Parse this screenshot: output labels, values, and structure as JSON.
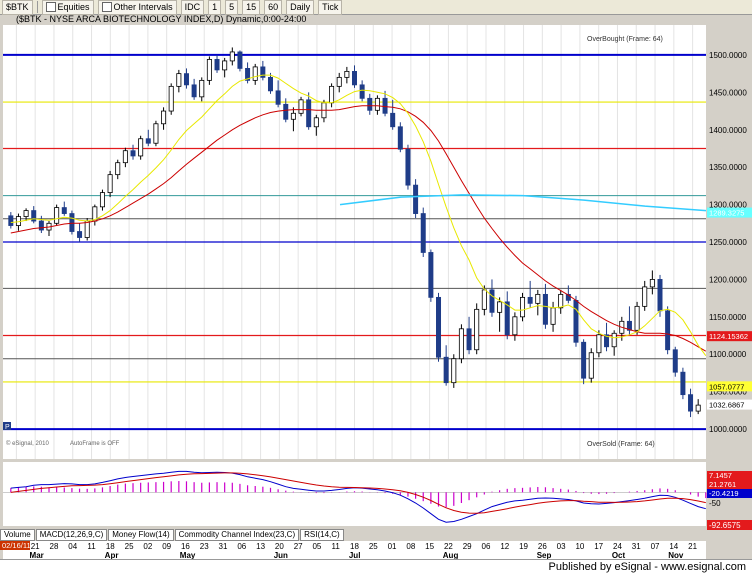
{
  "toolbar": {
    "symbol": "$BTK",
    "equities_label": "Equities",
    "other_intervals_label": "Other Intervals",
    "idc_label": "IDC",
    "intervals": [
      "1",
      "5",
      "15",
      "60",
      "Daily",
      "Tick"
    ]
  },
  "chart_data": {
    "type": "candlestick",
    "title": "($BTK - NYSE ARCA BIOTECHNOLOGY INDEX,D) Dynamic,0:00-24:00",
    "ylim": [
      960,
      1540
    ],
    "y_ticks": [
      "1500.0000",
      "1450.0000",
      "1400.0000",
      "1350.0000",
      "1300.0000",
      "1250.0000",
      "1200.0000",
      "1150.0000",
      "1100.0000",
      "1050.0000",
      "1000.0000"
    ],
    "x_day_labels": [
      "14",
      "21",
      "28",
      "04",
      "11",
      "18",
      "25",
      "02",
      "09",
      "16",
      "23",
      "31",
      "06",
      "13",
      "20",
      "27",
      "05",
      "11",
      "18",
      "25",
      "01",
      "08",
      "15",
      "22",
      "29",
      "06",
      "12",
      "19",
      "26",
      "03",
      "10",
      "17",
      "24",
      "31",
      "07",
      "14",
      "21"
    ],
    "x_month_labels": [
      "Mar",
      "Apr",
      "May",
      "Jun",
      "Jul",
      "Aug",
      "Sep",
      "Oct",
      "Nov"
    ],
    "date_label": "02/16/11",
    "price_labels": [
      {
        "text": "1124.15362",
        "value": 1124.15,
        "color": "#e31a1c"
      },
      {
        "text": "1057.0777",
        "value": 1057.08,
        "color": "#ffff33"
      },
      {
        "text": "1032.6867",
        "value": 1032.69,
        "color": "#ffffff"
      },
      {
        "text": "1289.3275",
        "value": 1289.33,
        "color": "#66ffff"
      }
    ],
    "horizontal_levels": [
      {
        "value": 1500,
        "color": "#0000cc",
        "width": 2
      },
      {
        "value": 1437,
        "color": "#e8e800",
        "width": 1.2
      },
      {
        "value": 1375,
        "color": "#e31a1c",
        "width": 1.2
      },
      {
        "value": 1312,
        "color": "#339999",
        "width": 1
      },
      {
        "value": 1281,
        "color": "#555555",
        "width": 1
      },
      {
        "value": 1250,
        "color": "#0000cc",
        "width": 1.2
      },
      {
        "value": 1188,
        "color": "#555555",
        "width": 1
      },
      {
        "value": 1125,
        "color": "#e31a1c",
        "width": 1.2
      },
      {
        "value": 1094,
        "color": "#555555",
        "width": 1
      },
      {
        "value": 1063,
        "color": "#e8e800",
        "width": 1.2
      },
      {
        "value": 1000,
        "color": "#0000cc",
        "width": 2
      }
    ],
    "annotations": {
      "overbought": "OverBought (Frame: 64)",
      "oversold": "OverSold (Frame: 64)",
      "autoframe": "AutoFrame is OFF",
      "copyright": "© eSignal, 2010"
    },
    "candles": [
      [
        1285,
        1290,
        1268,
        1272
      ],
      [
        1272,
        1288,
        1265,
        1284
      ],
      [
        1284,
        1295,
        1278,
        1292
      ],
      [
        1292,
        1298,
        1275,
        1278
      ],
      [
        1278,
        1285,
        1262,
        1266
      ],
      [
        1266,
        1278,
        1258,
        1275
      ],
      [
        1275,
        1300,
        1272,
        1296
      ],
      [
        1296,
        1304,
        1285,
        1288
      ],
      [
        1288,
        1292,
        1260,
        1264
      ],
      [
        1264,
        1275,
        1250,
        1256
      ],
      [
        1256,
        1282,
        1252,
        1278
      ],
      [
        1278,
        1300,
        1272,
        1297
      ],
      [
        1297,
        1320,
        1292,
        1316
      ],
      [
        1316,
        1345,
        1310,
        1340
      ],
      [
        1340,
        1360,
        1334,
        1356
      ],
      [
        1356,
        1376,
        1350,
        1372
      ],
      [
        1372,
        1380,
        1360,
        1365
      ],
      [
        1365,
        1392,
        1360,
        1388
      ],
      [
        1388,
        1400,
        1378,
        1382
      ],
      [
        1382,
        1412,
        1378,
        1408
      ],
      [
        1408,
        1430,
        1400,
        1425
      ],
      [
        1425,
        1462,
        1420,
        1458
      ],
      [
        1458,
        1480,
        1450,
        1475
      ],
      [
        1475,
        1482,
        1455,
        1460
      ],
      [
        1460,
        1468,
        1440,
        1444
      ],
      [
        1444,
        1470,
        1438,
        1466
      ],
      [
        1466,
        1498,
        1460,
        1494
      ],
      [
        1494,
        1500,
        1476,
        1480
      ],
      [
        1480,
        1496,
        1470,
        1492
      ],
      [
        1492,
        1510,
        1486,
        1504
      ],
      [
        1504,
        1506,
        1478,
        1482
      ],
      [
        1482,
        1490,
        1462,
        1466
      ],
      [
        1466,
        1488,
        1460,
        1484
      ],
      [
        1484,
        1492,
        1466,
        1470
      ],
      [
        1470,
        1476,
        1448,
        1452
      ],
      [
        1452,
        1466,
        1430,
        1434
      ],
      [
        1434,
        1442,
        1410,
        1414
      ],
      [
        1414,
        1430,
        1398,
        1422
      ],
      [
        1422,
        1444,
        1418,
        1440
      ],
      [
        1440,
        1450,
        1400,
        1404
      ],
      [
        1404,
        1420,
        1392,
        1416
      ],
      [
        1416,
        1440,
        1410,
        1436
      ],
      [
        1436,
        1462,
        1430,
        1458
      ],
      [
        1458,
        1476,
        1450,
        1470
      ],
      [
        1470,
        1484,
        1462,
        1478
      ],
      [
        1478,
        1486,
        1456,
        1460
      ],
      [
        1460,
        1466,
        1438,
        1442
      ],
      [
        1442,
        1448,
        1420,
        1426
      ],
      [
        1426,
        1446,
        1420,
        1442
      ],
      [
        1442,
        1452,
        1418,
        1422
      ],
      [
        1422,
        1440,
        1400,
        1404
      ],
      [
        1404,
        1410,
        1370,
        1374
      ],
      [
        1374,
        1380,
        1320,
        1326
      ],
      [
        1326,
        1334,
        1282,
        1288
      ],
      [
        1288,
        1296,
        1230,
        1236
      ],
      [
        1236,
        1240,
        1170,
        1176
      ],
      [
        1176,
        1182,
        1090,
        1096
      ],
      [
        1096,
        1112,
        1058,
        1062
      ],
      [
        1062,
        1100,
        1055,
        1094
      ],
      [
        1094,
        1140,
        1088,
        1134
      ],
      [
        1134,
        1150,
        1100,
        1106
      ],
      [
        1106,
        1168,
        1100,
        1160
      ],
      [
        1160,
        1192,
        1152,
        1186
      ],
      [
        1186,
        1200,
        1150,
        1156
      ],
      [
        1156,
        1176,
        1130,
        1170
      ],
      [
        1170,
        1184,
        1120,
        1126
      ],
      [
        1126,
        1156,
        1118,
        1150
      ],
      [
        1150,
        1182,
        1144,
        1176
      ],
      [
        1176,
        1198,
        1162,
        1168
      ],
      [
        1168,
        1186,
        1152,
        1180
      ],
      [
        1180,
        1194,
        1134,
        1140
      ],
      [
        1140,
        1170,
        1130,
        1162
      ],
      [
        1162,
        1186,
        1154,
        1180
      ],
      [
        1180,
        1192,
        1168,
        1172
      ],
      [
        1172,
        1178,
        1110,
        1116
      ],
      [
        1116,
        1120,
        1060,
        1068
      ],
      [
        1068,
        1108,
        1062,
        1102
      ],
      [
        1102,
        1132,
        1096,
        1126
      ],
      [
        1126,
        1142,
        1104,
        1110
      ],
      [
        1110,
        1132,
        1098,
        1128
      ],
      [
        1128,
        1150,
        1118,
        1144
      ],
      [
        1144,
        1164,
        1126,
        1132
      ],
      [
        1132,
        1170,
        1126,
        1164
      ],
      [
        1164,
        1198,
        1158,
        1190
      ],
      [
        1190,
        1212,
        1180,
        1200
      ],
      [
        1200,
        1206,
        1150,
        1158
      ],
      [
        1158,
        1164,
        1100,
        1106
      ],
      [
        1106,
        1110,
        1070,
        1076
      ],
      [
        1076,
        1082,
        1040,
        1046
      ],
      [
        1046,
        1054,
        1016,
        1024
      ],
      [
        1024,
        1040,
        1020,
        1032
      ]
    ],
    "ma_fast": [
      1276,
      1277,
      1279,
      1281,
      1280,
      1279,
      1281,
      1283,
      1282,
      1279,
      1278,
      1280,
      1285,
      1292,
      1301,
      1311,
      1320,
      1330,
      1339,
      1349,
      1360,
      1373,
      1387,
      1399,
      1408,
      1417,
      1428,
      1439,
      1448,
      1458,
      1465,
      1468,
      1471,
      1473,
      1473,
      1469,
      1462,
      1455,
      1449,
      1445,
      1439,
      1436,
      1436,
      1440,
      1446,
      1451,
      1453,
      1452,
      1450,
      1448,
      1443,
      1435,
      1422,
      1405,
      1384,
      1358,
      1327,
      1297,
      1269,
      1245,
      1226,
      1202,
      1187,
      1178,
      1172,
      1166,
      1159,
      1159,
      1162,
      1165,
      1164,
      1162,
      1163,
      1166,
      1160,
      1146,
      1134,
      1128,
      1124,
      1122,
      1123,
      1126,
      1130,
      1138,
      1148,
      1158,
      1160,
      1156,
      1146,
      1130,
      1112,
      1098
    ],
    "ma_slow": [
      1262,
      1264,
      1266,
      1268,
      1269,
      1270,
      1272,
      1274,
      1275,
      1275,
      1276,
      1278,
      1281,
      1285,
      1290,
      1296,
      1302,
      1308,
      1314,
      1321,
      1328,
      1336,
      1345,
      1354,
      1362,
      1370,
      1378,
      1386,
      1393,
      1400,
      1406,
      1411,
      1416,
      1420,
      1423,
      1425,
      1426,
      1427,
      1427,
      1427,
      1426,
      1426,
      1426,
      1427,
      1429,
      1431,
      1432,
      1432,
      1432,
      1431,
      1430,
      1428,
      1424,
      1418,
      1410,
      1399,
      1385,
      1368,
      1350,
      1332,
      1315,
      1298,
      1282,
      1268,
      1255,
      1243,
      1232,
      1222,
      1214,
      1206,
      1198,
      1191,
      1185,
      1179,
      1172,
      1164,
      1157,
      1151,
      1145,
      1140,
      1136,
      1133,
      1130,
      1128,
      1128,
      1128,
      1127,
      1125,
      1121,
      1116,
      1110,
      1104
    ],
    "cyan_curve": [
      1300,
      1310,
      1313,
      1312,
      1306,
      1298,
      1292
    ],
    "macd_hist": [
      0.3,
      0.35,
      0.4,
      0.42,
      0.4,
      0.36,
      0.35,
      0.34,
      0.3,
      0.26,
      0.25,
      0.28,
      0.35,
      0.45,
      0.55,
      0.62,
      0.65,
      0.68,
      0.7,
      0.72,
      0.74,
      0.78,
      0.8,
      0.78,
      0.72,
      0.68,
      0.7,
      0.72,
      0.7,
      0.68,
      0.6,
      0.5,
      0.45,
      0.4,
      0.32,
      0.22,
      0.12,
      0.05,
      0.02,
      -0.02,
      -0.05,
      -0.05,
      -0.02,
      0.02,
      0.06,
      0.08,
      0.06,
      0.02,
      -0.02,
      -0.05,
      -0.1,
      -0.18,
      -0.3,
      -0.45,
      -0.62,
      -0.8,
      -1.0,
      -1.05,
      -0.95,
      -0.75,
      -0.55,
      -0.35,
      -0.15,
      0.05,
      0.15,
      0.25,
      0.3,
      0.32,
      0.35,
      0.38,
      0.36,
      0.3,
      0.25,
      0.2,
      0.1,
      -0.05,
      -0.1,
      -0.12,
      -0.1,
      -0.05,
      0.0,
      0.05,
      0.1,
      0.15,
      0.22,
      0.28,
      0.25,
      0.15,
      0.0,
      -0.15,
      -0.3,
      -0.4
    ],
    "macd_line": [
      0.3,
      0.35,
      0.4,
      0.5,
      0.55,
      0.55,
      0.58,
      0.62,
      0.6,
      0.55,
      0.55,
      0.6,
      0.7,
      0.82,
      0.95,
      1.05,
      1.12,
      1.18,
      1.24,
      1.3,
      1.35,
      1.42,
      1.48,
      1.48,
      1.42,
      1.38,
      1.4,
      1.42,
      1.4,
      1.36,
      1.25,
      1.1,
      1.0,
      0.9,
      0.75,
      0.58,
      0.4,
      0.28,
      0.22,
      0.15,
      0.1,
      0.1,
      0.14,
      0.2,
      0.28,
      0.32,
      0.3,
      0.24,
      0.18,
      0.1,
      -0.02,
      -0.2,
      -0.45,
      -0.75,
      -1.1,
      -1.5,
      -1.9,
      -2.1,
      -2.05,
      -1.9,
      -1.7,
      -1.5,
      -1.25,
      -1.0,
      -0.85,
      -0.7,
      -0.6,
      -0.55,
      -0.48,
      -0.42,
      -0.4,
      -0.42,
      -0.46,
      -0.5,
      -0.6,
      -0.75,
      -0.8,
      -0.82,
      -0.78,
      -0.72,
      -0.65,
      -0.58,
      -0.5,
      -0.42,
      -0.3,
      -0.2,
      -0.22,
      -0.35,
      -0.55,
      -0.78,
      -1.0,
      -1.15
    ],
    "signal_line": [
      0.0,
      0.07,
      0.14,
      0.21,
      0.28,
      0.33,
      0.38,
      0.42,
      0.46,
      0.48,
      0.49,
      0.51,
      0.55,
      0.61,
      0.68,
      0.76,
      0.83,
      0.9,
      0.97,
      1.04,
      1.1,
      1.16,
      1.23,
      1.28,
      1.31,
      1.32,
      1.34,
      1.36,
      1.37,
      1.37,
      1.35,
      1.3,
      1.24,
      1.17,
      1.09,
      1.0,
      0.9,
      0.8,
      0.7,
      0.61,
      0.52,
      0.45,
      0.39,
      0.36,
      0.35,
      0.34,
      0.33,
      0.31,
      0.28,
      0.24,
      0.19,
      0.11,
      0.0,
      -0.15,
      -0.34,
      -0.57,
      -0.84,
      -1.09,
      -1.28,
      -1.4,
      -1.46,
      -1.47,
      -1.43,
      -1.34,
      -1.25,
      -1.15,
      -1.04,
      -0.95,
      -0.86,
      -0.77,
      -0.69,
      -0.64,
      -0.6,
      -0.58,
      -0.58,
      -0.62,
      -0.65,
      -0.69,
      -0.7,
      -0.71,
      -0.7,
      -0.68,
      -0.65,
      -0.6,
      -0.54,
      -0.47,
      -0.42,
      -0.41,
      -0.44,
      -0.51,
      -0.61,
      -0.72
    ],
    "macd_ylim": [
      -2.3,
      2.0
    ],
    "macd_labels": [
      {
        "text": "7.1457",
        "color": "#e31a1c"
      },
      {
        "text": "21.2761",
        "color": "#e31a1c"
      },
      {
        "text": "-20.4219",
        "color": "#0000cc"
      }
    ],
    "lower_labels": {
      "minus50": "-50",
      "bottom": "-92.6575"
    }
  },
  "tabs": [
    "Volume",
    "MACD(12,26,9,C)",
    "Money Flow(14)",
    "Commodity Channel Index(23,C)",
    "RSI(14,C)"
  ],
  "footer": {
    "text": "Published by eSignal - www.esignal.com"
  },
  "colors": {
    "background": "#ffffff",
    "candle_up": "#000000",
    "candle_down": "#1f3c88",
    "ma_fast": "#e8e800",
    "ma_slow": "#cc0000",
    "cyan": "#33ccff",
    "macd_hist": "#cc00cc"
  }
}
